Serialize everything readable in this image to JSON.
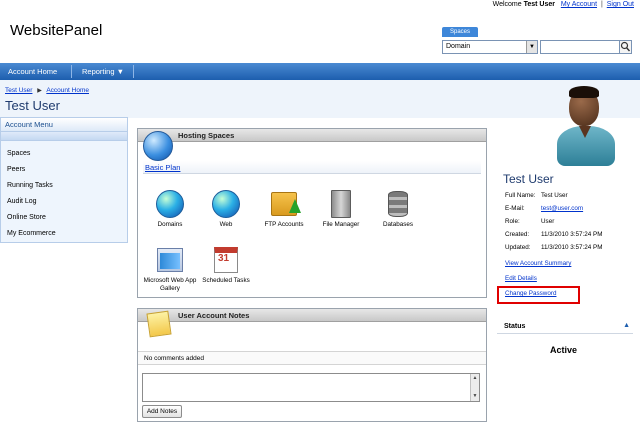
{
  "header": {
    "welcome_prefix": "Welcome",
    "user_name": "Test User",
    "my_account": "My Account",
    "separator": "|",
    "sign_out": "Sign Out",
    "brand": "WebsitePanel",
    "spaces_tab": "Spaces",
    "space_select_value": "Domain",
    "dropdown_glyph": "▼"
  },
  "navbar": {
    "items": [
      {
        "label": "Account Home"
      },
      {
        "label": "Reporting ▼"
      }
    ]
  },
  "breadcrumb": {
    "items": [
      "Test User",
      "Account Home"
    ],
    "arrow": "▶"
  },
  "page_title": "Test User",
  "sidebar": {
    "title": "Account Menu",
    "items": [
      "Spaces",
      "Peers",
      "Running Tasks",
      "Audit Log",
      "Online Store",
      "My Ecommerce"
    ]
  },
  "hosting_spaces": {
    "title": "Hosting Spaces",
    "plan_link": "Basic Plan",
    "services": [
      {
        "label": "Domains",
        "icon": "globe-icon"
      },
      {
        "label": "Web",
        "icon": "globe-icon"
      },
      {
        "label": "FTP Accounts",
        "icon": "ftp-folder-icon"
      },
      {
        "label": "File Manager",
        "icon": "file-cabinet-icon"
      },
      {
        "label": "Databases",
        "icon": "database-icon"
      },
      {
        "label": "Microsoft Web App Gallery",
        "icon": "web-app-icon"
      },
      {
        "label": "Scheduled Tasks",
        "icon": "calendar-icon"
      }
    ]
  },
  "notes": {
    "title": "User Account Notes",
    "empty_text": "No comments added",
    "add_button": "Add Notes",
    "scroll_up": "▲",
    "scroll_down": "▼"
  },
  "profile": {
    "name": "Test User",
    "fields": [
      {
        "key": "Full Name:",
        "value": "Test User",
        "link": false
      },
      {
        "key": "E-Mail:",
        "value": "test@user.com",
        "link": true
      },
      {
        "key": "Role:",
        "value": "User",
        "link": false
      },
      {
        "key": "Created:",
        "value": "11/3/2010 3:57:24 PM",
        "link": false
      },
      {
        "key": "Updated:",
        "value": "11/3/2010 3:57:24 PM",
        "link": false
      }
    ],
    "view_summary": "View Account Summary",
    "edit_details": "Edit Details",
    "change_password": "Change Password",
    "highlight_color": "#e00000"
  },
  "status": {
    "title": "Status",
    "value": "Active",
    "caret": "▲"
  },
  "colors": {
    "nav_blue": "#1d5eae",
    "link_blue": "#0033cc",
    "title_blue": "#1f3b6e"
  }
}
